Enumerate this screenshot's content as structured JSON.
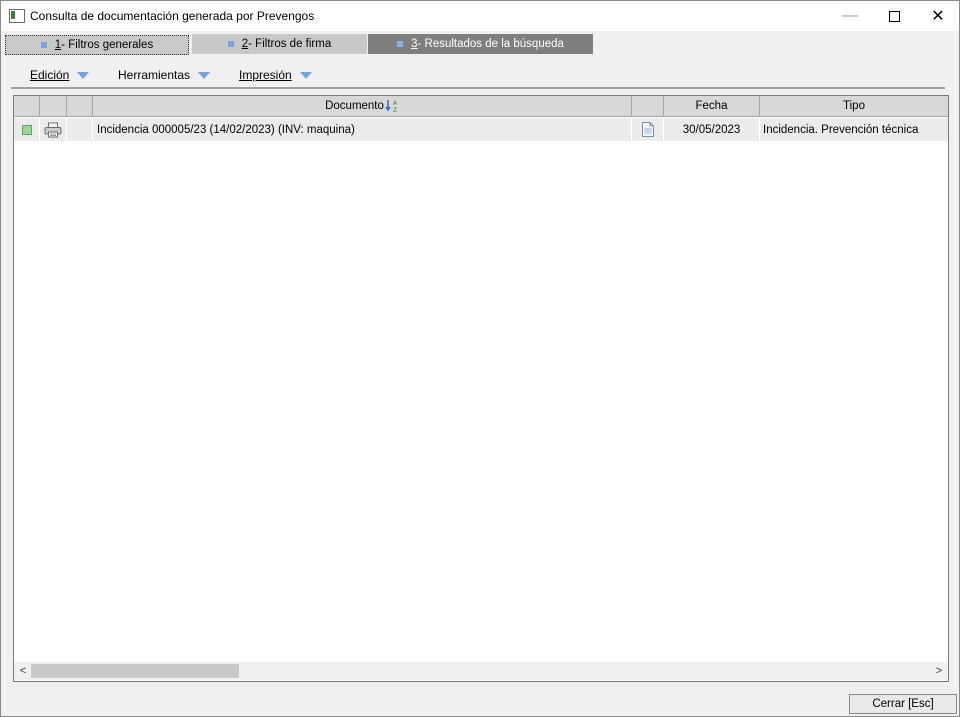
{
  "window": {
    "title": "Consulta de documentación generada por Prevengos",
    "minimize_glyph": "—",
    "close_glyph": "✕"
  },
  "tabs": [
    {
      "num": "1",
      "label": " - Filtros generales"
    },
    {
      "num": "2",
      "label": " - Filtros de firma"
    },
    {
      "num": "3",
      "label": " - Resultados de la búsqueda"
    }
  ],
  "toolbar": {
    "edicion": "Edición",
    "herramientas": "Herramientas",
    "impresion": "Impresión"
  },
  "grid": {
    "columns": [
      "",
      "",
      "",
      "Documento",
      "",
      "Fecha",
      "Tipo"
    ],
    "sort_column": "Documento",
    "rows": [
      {
        "documento": "Incidencia 000005/23 (14/02/2023) (INV: maquina)",
        "fecha": "30/05/2023",
        "tipo": "Incidencia. Prevención técnica"
      }
    ]
  },
  "scrollbar": {
    "left": "<",
    "right": ">"
  },
  "buttons": {
    "cerrar": "Cerrar [Esc]"
  },
  "colors": {
    "accent": "#7aa2d9",
    "active_tab": "#7f7f7f"
  }
}
